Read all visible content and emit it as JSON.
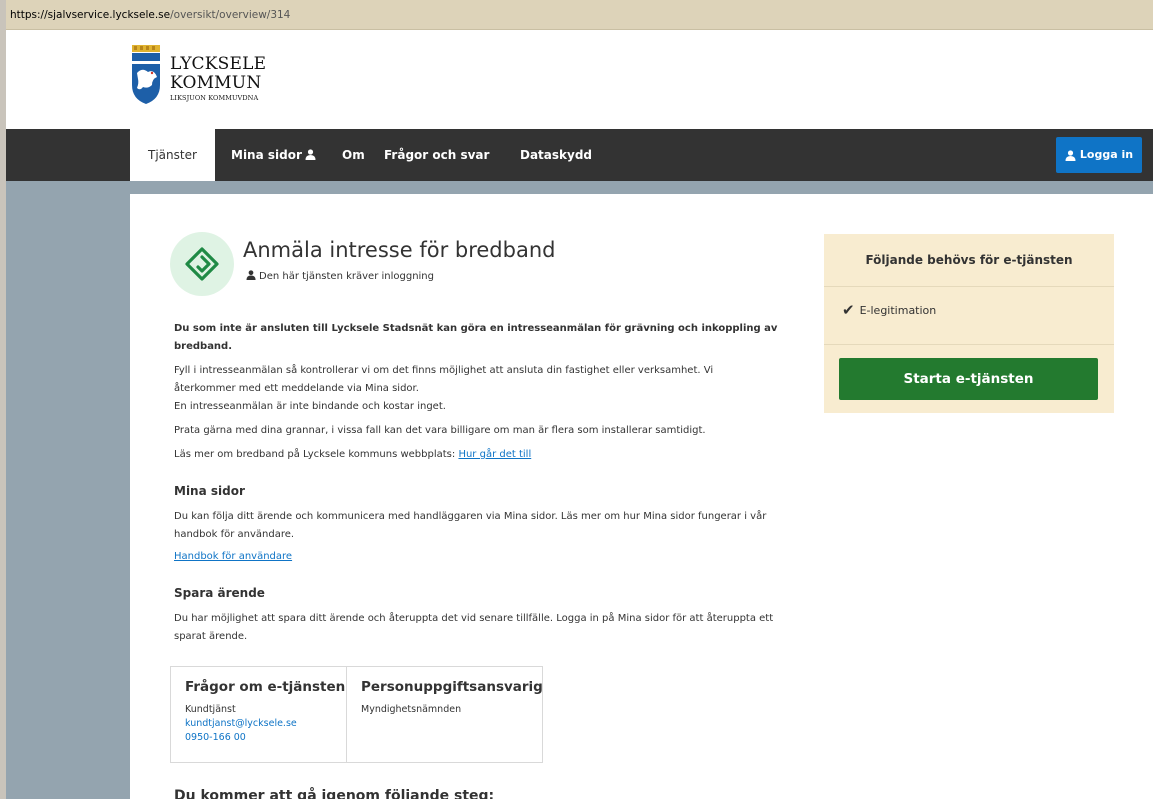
{
  "browser": {
    "url_host": "https://sjalvservice.lycksele.se",
    "url_path": "/oversikt/overview/314"
  },
  "header": {
    "logo_line1": "LYCKSELE",
    "logo_line2": "KOMMUN",
    "logo_line3": "LIKSJUON KOMMUVDNA"
  },
  "nav": {
    "items": [
      {
        "label": "Tjänster"
      },
      {
        "label": "Mina sidor"
      },
      {
        "label": "Om"
      },
      {
        "label": "Frågor och svar"
      },
      {
        "label": "Dataskydd"
      }
    ],
    "login_label": "Logga in"
  },
  "service": {
    "title": "Anmäla intresse för bredband",
    "login_note": "Den här tjänsten kräver inloggning",
    "intro_line1": "Du som inte är ansluten till Lycksele Stadsnät kan göra en intresseanmälan för grävning och inkoppling av",
    "intro_line2": "bredband.",
    "para1_line1": "Fyll i intresseanmälan så kontrollerar vi om det finns möjlighet att ansluta din fastighet eller verksamhet. Vi",
    "para1_line2": "återkommer med ett meddelande via Mina sidor.",
    "para1_line3": "En intresseanmälan är inte bindande och kostar inget.",
    "para2": "Prata gärna med dina grannar, i vissa fall kan det vara billigare om man är flera som installerar samtidigt.",
    "para3_prefix": "Läs mer om bredband på Lycksele kommuns webbplats:",
    "para3_link": "Hur går det till"
  },
  "mina_sidor": {
    "heading": "Mina sidor",
    "line1": "Du kan följa ditt ärende och kommunicera med handläggaren via Mina sidor. Läs mer om hur Mina sidor fungerar i vår",
    "line2": "handbok för användare.",
    "link": "Handbok för användare"
  },
  "spara": {
    "heading": "Spara ärende",
    "line1": "Du har möjlighet att spara ditt ärende och återuppta det vid senare tillfälle. Logga in på Mina sidor för att återuppta ett",
    "line2": "sparat ärende."
  },
  "contact": {
    "left_title": "Frågor om e-tjänsten",
    "left_name": "Kundtjänst",
    "left_email": "kundtjanst@lycksele.se",
    "left_phone": "0950-166 00",
    "right_title": "Personuppgiftsansvarig",
    "right_name": "Myndighetsnämnden"
  },
  "steps_heading": "Du kommer att gå igenom följande steg:",
  "sidebar": {
    "title": "Följande behövs för e-tjänsten",
    "requirement": "E-legitimation",
    "start_label": "Starta e-tjänsten"
  },
  "colors": {
    "nav_bg": "#333333",
    "login_blue": "#0f74c6",
    "start_green": "#237a2f",
    "side_box_bg": "#f8ecd0",
    "page_bg": "#94a4af"
  }
}
